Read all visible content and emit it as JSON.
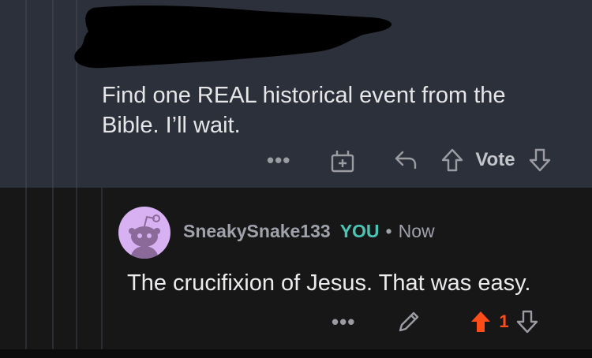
{
  "parent_comment": {
    "text": "Find one REAL historical event from the Bible. I’ll wait.",
    "more_label": "•••",
    "vote_label": "Vote"
  },
  "reply": {
    "username": "SneakySnake133",
    "you_badge": "YOU",
    "separator": "•",
    "timestamp": "Now",
    "text": "The crucifixion of Jesus. That was easy.",
    "more_label": "•••",
    "score": "1"
  },
  "colors": {
    "accent_upvote": "#ff4d1a",
    "you_badge": "#4bc4b4",
    "avatar_bg": "#d8b1f2"
  },
  "icons": [
    "gift-icon",
    "reply-arrow-icon",
    "upvote-icon",
    "downvote-icon",
    "edit-pencil-icon",
    "snoo-avatar-icon"
  ]
}
